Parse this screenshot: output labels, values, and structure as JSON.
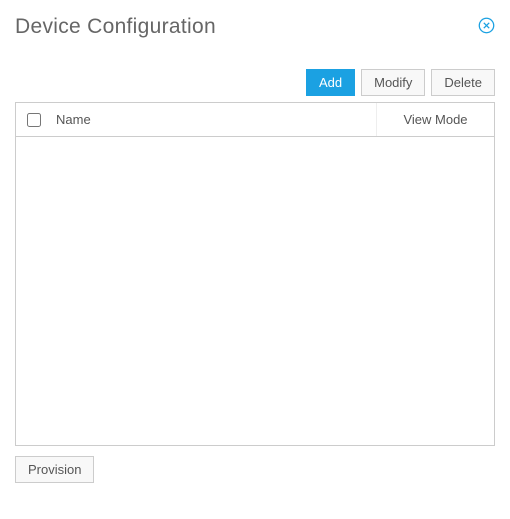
{
  "title": "Device Configuration",
  "toolbar": {
    "add_label": "Add",
    "modify_label": "Modify",
    "delete_label": "Delete"
  },
  "table": {
    "columns": {
      "name": "Name",
      "view_mode": "View Mode"
    },
    "rows": []
  },
  "footer": {
    "provision_label": "Provision"
  }
}
